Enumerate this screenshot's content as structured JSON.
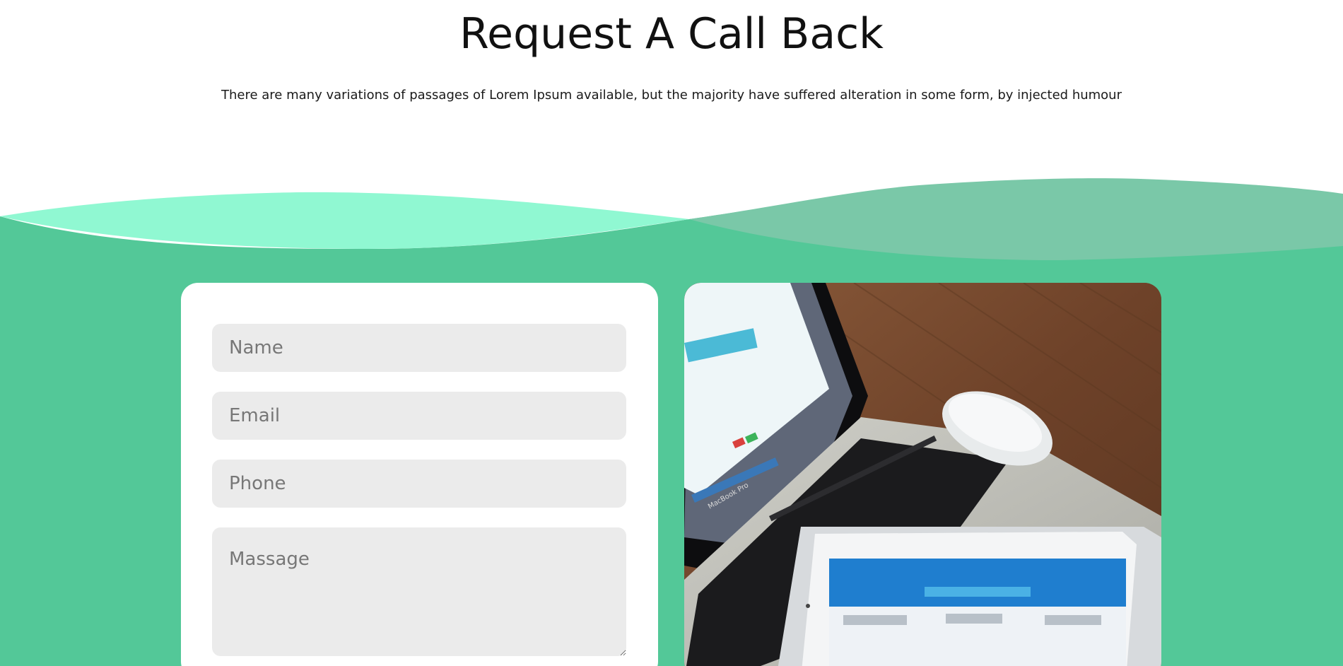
{
  "section": {
    "title": "Request A Call Back",
    "subtitle": "There are many variations of passages of Lorem Ipsum available, but the majority have suffered alteration in some form, by injected humour"
  },
  "form": {
    "name_placeholder": "Name",
    "email_placeholder": "Email",
    "phone_placeholder": "Phone",
    "message_placeholder": "Massage"
  },
  "photo": {
    "laptop_label": "MacBook Pro"
  },
  "colors": {
    "background_green": "#53c898",
    "wave_light": "#90f8d2",
    "wave_dark": "#7ac8a8",
    "field_bg": "#ebebeb"
  }
}
